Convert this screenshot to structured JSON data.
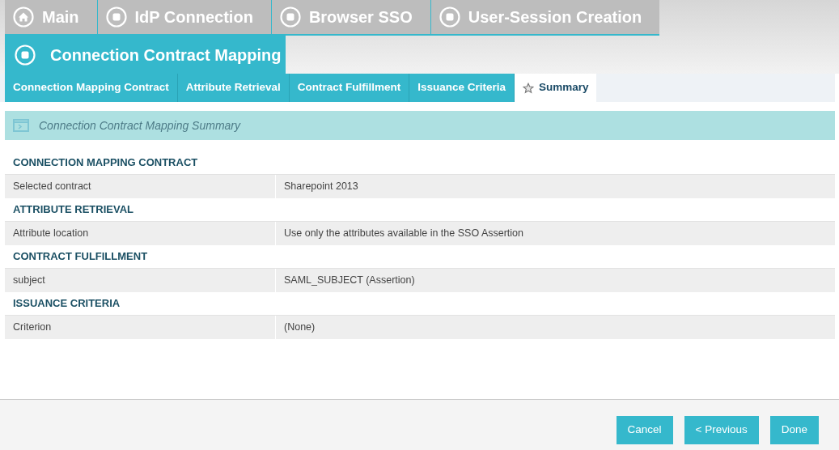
{
  "breadcrumb_tabs": [
    {
      "label": "Main",
      "kind": "home"
    },
    {
      "label": "IdP Connection",
      "kind": "step"
    },
    {
      "label": "Browser SSO",
      "kind": "step"
    },
    {
      "label": "User-Session Creation",
      "kind": "step"
    }
  ],
  "current_step": {
    "label": "Connection Contract Mapping"
  },
  "tabs": [
    {
      "label": "Connection Mapping Contract",
      "selected": false
    },
    {
      "label": "Attribute Retrieval",
      "selected": false
    },
    {
      "label": "Contract Fulfillment",
      "selected": false
    },
    {
      "label": "Issuance Criteria",
      "selected": false
    },
    {
      "label": "Summary",
      "selected": true
    }
  ],
  "panel_title": "Connection Contract Mapping Summary",
  "sections": [
    {
      "heading": "CONNECTION MAPPING CONTRACT",
      "rows": [
        {
          "label": "Selected contract",
          "value": "Sharepoint 2013"
        }
      ]
    },
    {
      "heading": "ATTRIBUTE RETRIEVAL",
      "rows": [
        {
          "label": "Attribute location",
          "value": "Use only the attributes available in the SSO Assertion"
        }
      ]
    },
    {
      "heading": "CONTRACT FULFILLMENT",
      "rows": [
        {
          "label": "subject",
          "value": "SAML_SUBJECT (Assertion)"
        }
      ]
    },
    {
      "heading": "ISSUANCE CRITERIA",
      "rows": [
        {
          "label": "Criterion",
          "value": "(None)"
        }
      ]
    }
  ],
  "buttons": [
    "Cancel",
    "< Previous",
    "Done"
  ]
}
